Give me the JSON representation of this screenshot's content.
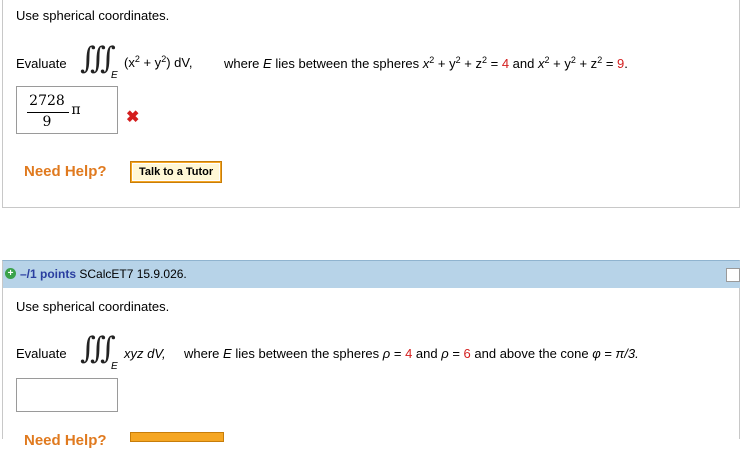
{
  "q1": {
    "instruction": "Use spherical coordinates.",
    "evaluate_label": "Evaluate",
    "integral_symbol": "∭",
    "integral_sub": "E",
    "integrand_open": "(x",
    "exp2": "2",
    "plus": " + y",
    "integrand_close": ") dV,",
    "where_text": "where",
    "E_var": "E",
    "lies_text": "lies between the spheres",
    "sphere1_lhs": "x",
    "s_plus_y": " + y",
    "s_plus_z": " + z",
    "eq": " = ",
    "r1": "4",
    "and_text": "and",
    "r2": "9",
    "period": ".",
    "answer_num": "2728",
    "answer_den": "9",
    "answer_pi": "π",
    "wrong_mark": "✖",
    "need_help": "Need Help?",
    "tutor_button": "Talk to a Tutor"
  },
  "q2": {
    "points_label": "–/1 points",
    "problem_id": "SCalcET7 15.9.026.",
    "plus_icon": "+",
    "instruction": "Use spherical coordinates.",
    "evaluate_label": "Evaluate",
    "integral_symbol": "∭",
    "integral_sub": "E",
    "integrand": "xyz dV,",
    "where_text": "where",
    "E_var": "E",
    "lies_text": "lies between the spheres",
    "rho": "ρ",
    "eq": " = ",
    "r1": "4",
    "and_text": "and",
    "r2": "6",
    "cone_text": "and above the cone",
    "phi": "φ",
    "angle": "π/3.",
    "need_help_partial": "Need Help?"
  },
  "colors": {
    "header_bg": "#b7d3e8",
    "need_help": "#e07a1f",
    "error_mark": "#d41e1e",
    "points_text": "#2a3ea0"
  }
}
